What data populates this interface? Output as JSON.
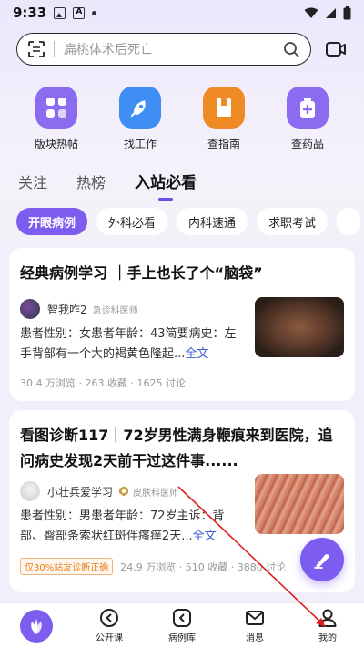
{
  "status": {
    "time": "9:33"
  },
  "search": {
    "placeholder": "扁桃体术后死亡"
  },
  "quick": [
    {
      "label": "版块热帖",
      "icon": "grid-icon",
      "color": "#8b6cf1"
    },
    {
      "label": "找工作",
      "icon": "rocket-icon",
      "color": "#3f8ef4"
    },
    {
      "label": "查指南",
      "icon": "book-icon",
      "color": "#f08a24"
    },
    {
      "label": "查药品",
      "icon": "medicine-icon",
      "color": "#8b6cf1"
    }
  ],
  "tabs": [
    "关注",
    "热榜",
    "入站必看"
  ],
  "chips": [
    "开眼病例",
    "外科必看",
    "内科速通",
    "求职考试"
  ],
  "cards": [
    {
      "title": "经典病例学习 ｜手上也长了个“脑袋”",
      "author": "智我咋2",
      "role": "急诊科医师",
      "text": "患者性别：女患者年龄：43简要病史：左手背部有一个大的褐黄色隆起...",
      "fulltext": "全文",
      "stats": "30.4 万浏览 · 263 收藏 · 1625 讨论"
    },
    {
      "title": "看图诊断117｜72岁男性满身鞭痕来到医院，追问病史发现2天前干过这件事......",
      "author": "小壮兵爱学习",
      "role": "皮肤科医师",
      "text": "患者性别：男患者年龄：72岁主诉：背部、臀部条索状红斑伴瘙痒2天...",
      "fulltext": "全文",
      "tag": "仅30%站友诊断正确",
      "stats": "24.9 万浏览 · 510 收藏 · 3880 讨论"
    }
  ],
  "nav": [
    {
      "label": "",
      "icon": "home-leaf-icon"
    },
    {
      "label": "公开课",
      "icon": "play-icon"
    },
    {
      "label": "病例库",
      "icon": "case-library-icon"
    },
    {
      "label": "消息",
      "icon": "mail-icon"
    },
    {
      "label": "我的",
      "icon": "profile-icon"
    }
  ],
  "colors": {
    "accent": "#7d5cf0",
    "link": "#3b5bd6",
    "orange": "#e8801a"
  }
}
